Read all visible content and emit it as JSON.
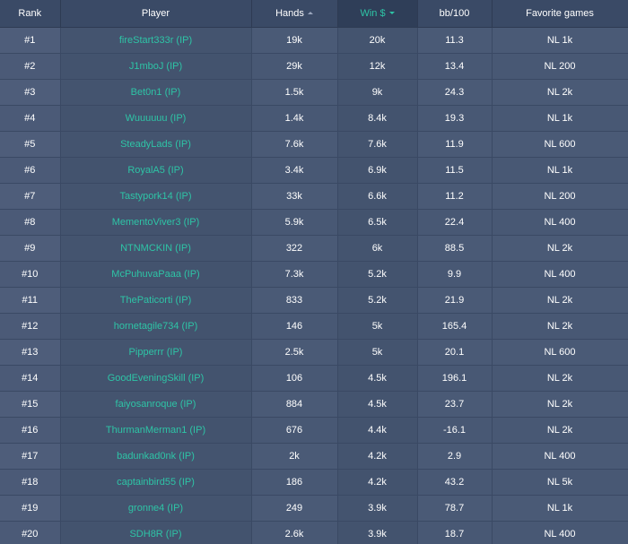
{
  "table": {
    "headers": {
      "rank": "Rank",
      "player": "Player",
      "hands": "Hands",
      "win": "Win $",
      "bb100": "bb/100",
      "favorite": "Favorite games"
    },
    "rows": [
      {
        "rank": "#1",
        "player": "fireStart333r (IP)",
        "hands": "19k",
        "win": "20k",
        "bb100": "11.3",
        "favorite": "NL 1k"
      },
      {
        "rank": "#2",
        "player": "J1mboJ (IP)",
        "hands": "29k",
        "win": "12k",
        "bb100": "13.4",
        "favorite": "NL 200"
      },
      {
        "rank": "#3",
        "player": "Bet0n1 (IP)",
        "hands": "1.5k",
        "win": "9k",
        "bb100": "24.3",
        "favorite": "NL 2k"
      },
      {
        "rank": "#4",
        "player": "Wuuuuuu (IP)",
        "hands": "1.4k",
        "win": "8.4k",
        "bb100": "19.3",
        "favorite": "NL 1k"
      },
      {
        "rank": "#5",
        "player": "SteadyLads (IP)",
        "hands": "7.6k",
        "win": "7.6k",
        "bb100": "11.9",
        "favorite": "NL 600"
      },
      {
        "rank": "#6",
        "player": "RoyalA5 (IP)",
        "hands": "3.4k",
        "win": "6.9k",
        "bb100": "11.5",
        "favorite": "NL 1k"
      },
      {
        "rank": "#7",
        "player": "Tastypork14 (IP)",
        "hands": "33k",
        "win": "6.6k",
        "bb100": "11.2",
        "favorite": "NL 200"
      },
      {
        "rank": "#8",
        "player": "MementoViver3 (IP)",
        "hands": "5.9k",
        "win": "6.5k",
        "bb100": "22.4",
        "favorite": "NL 400"
      },
      {
        "rank": "#9",
        "player": "NTNMCKIN (IP)",
        "hands": "322",
        "win": "6k",
        "bb100": "88.5",
        "favorite": "NL 2k"
      },
      {
        "rank": "#10",
        "player": "McPuhuvaPaaa (IP)",
        "hands": "7.3k",
        "win": "5.2k",
        "bb100": "9.9",
        "favorite": "NL 400"
      },
      {
        "rank": "#11",
        "player": "ThePaticorti (IP)",
        "hands": "833",
        "win": "5.2k",
        "bb100": "21.9",
        "favorite": "NL 2k"
      },
      {
        "rank": "#12",
        "player": "hornetagile734 (IP)",
        "hands": "146",
        "win": "5k",
        "bb100": "165.4",
        "favorite": "NL 2k"
      },
      {
        "rank": "#13",
        "player": "Pipperrr (IP)",
        "hands": "2.5k",
        "win": "5k",
        "bb100": "20.1",
        "favorite": "NL 600"
      },
      {
        "rank": "#14",
        "player": "GoodEveningSkill (IP)",
        "hands": "106",
        "win": "4.5k",
        "bb100": "196.1",
        "favorite": "NL 2k"
      },
      {
        "rank": "#15",
        "player": "faiyosanroque (IP)",
        "hands": "884",
        "win": "4.5k",
        "bb100": "23.7",
        "favorite": "NL 2k"
      },
      {
        "rank": "#16",
        "player": "ThurmanMerman1 (IP)",
        "hands": "676",
        "win": "4.4k",
        "bb100": "-16.1",
        "favorite": "NL 2k"
      },
      {
        "rank": "#17",
        "player": "badunkad0nk (IP)",
        "hands": "2k",
        "win": "4.2k",
        "bb100": "2.9",
        "favorite": "NL 400"
      },
      {
        "rank": "#18",
        "player": "captainbird55 (IP)",
        "hands": "186",
        "win": "4.2k",
        "bb100": "43.2",
        "favorite": "NL 5k"
      },
      {
        "rank": "#19",
        "player": "gronne4 (IP)",
        "hands": "249",
        "win": "3.9k",
        "bb100": "78.7",
        "favorite": "NL 1k"
      },
      {
        "rank": "#20",
        "player": "SDH8R (IP)",
        "hands": "2.6k",
        "win": "3.9k",
        "bb100": "18.7",
        "favorite": "NL 400"
      }
    ]
  },
  "sort": {
    "hands_icon": "sort-asc-icon",
    "win_icon": "sort-desc-icon"
  },
  "colors": {
    "accent": "#2ec4a6",
    "background": "#4a5a76",
    "header": "#3a4a66"
  }
}
